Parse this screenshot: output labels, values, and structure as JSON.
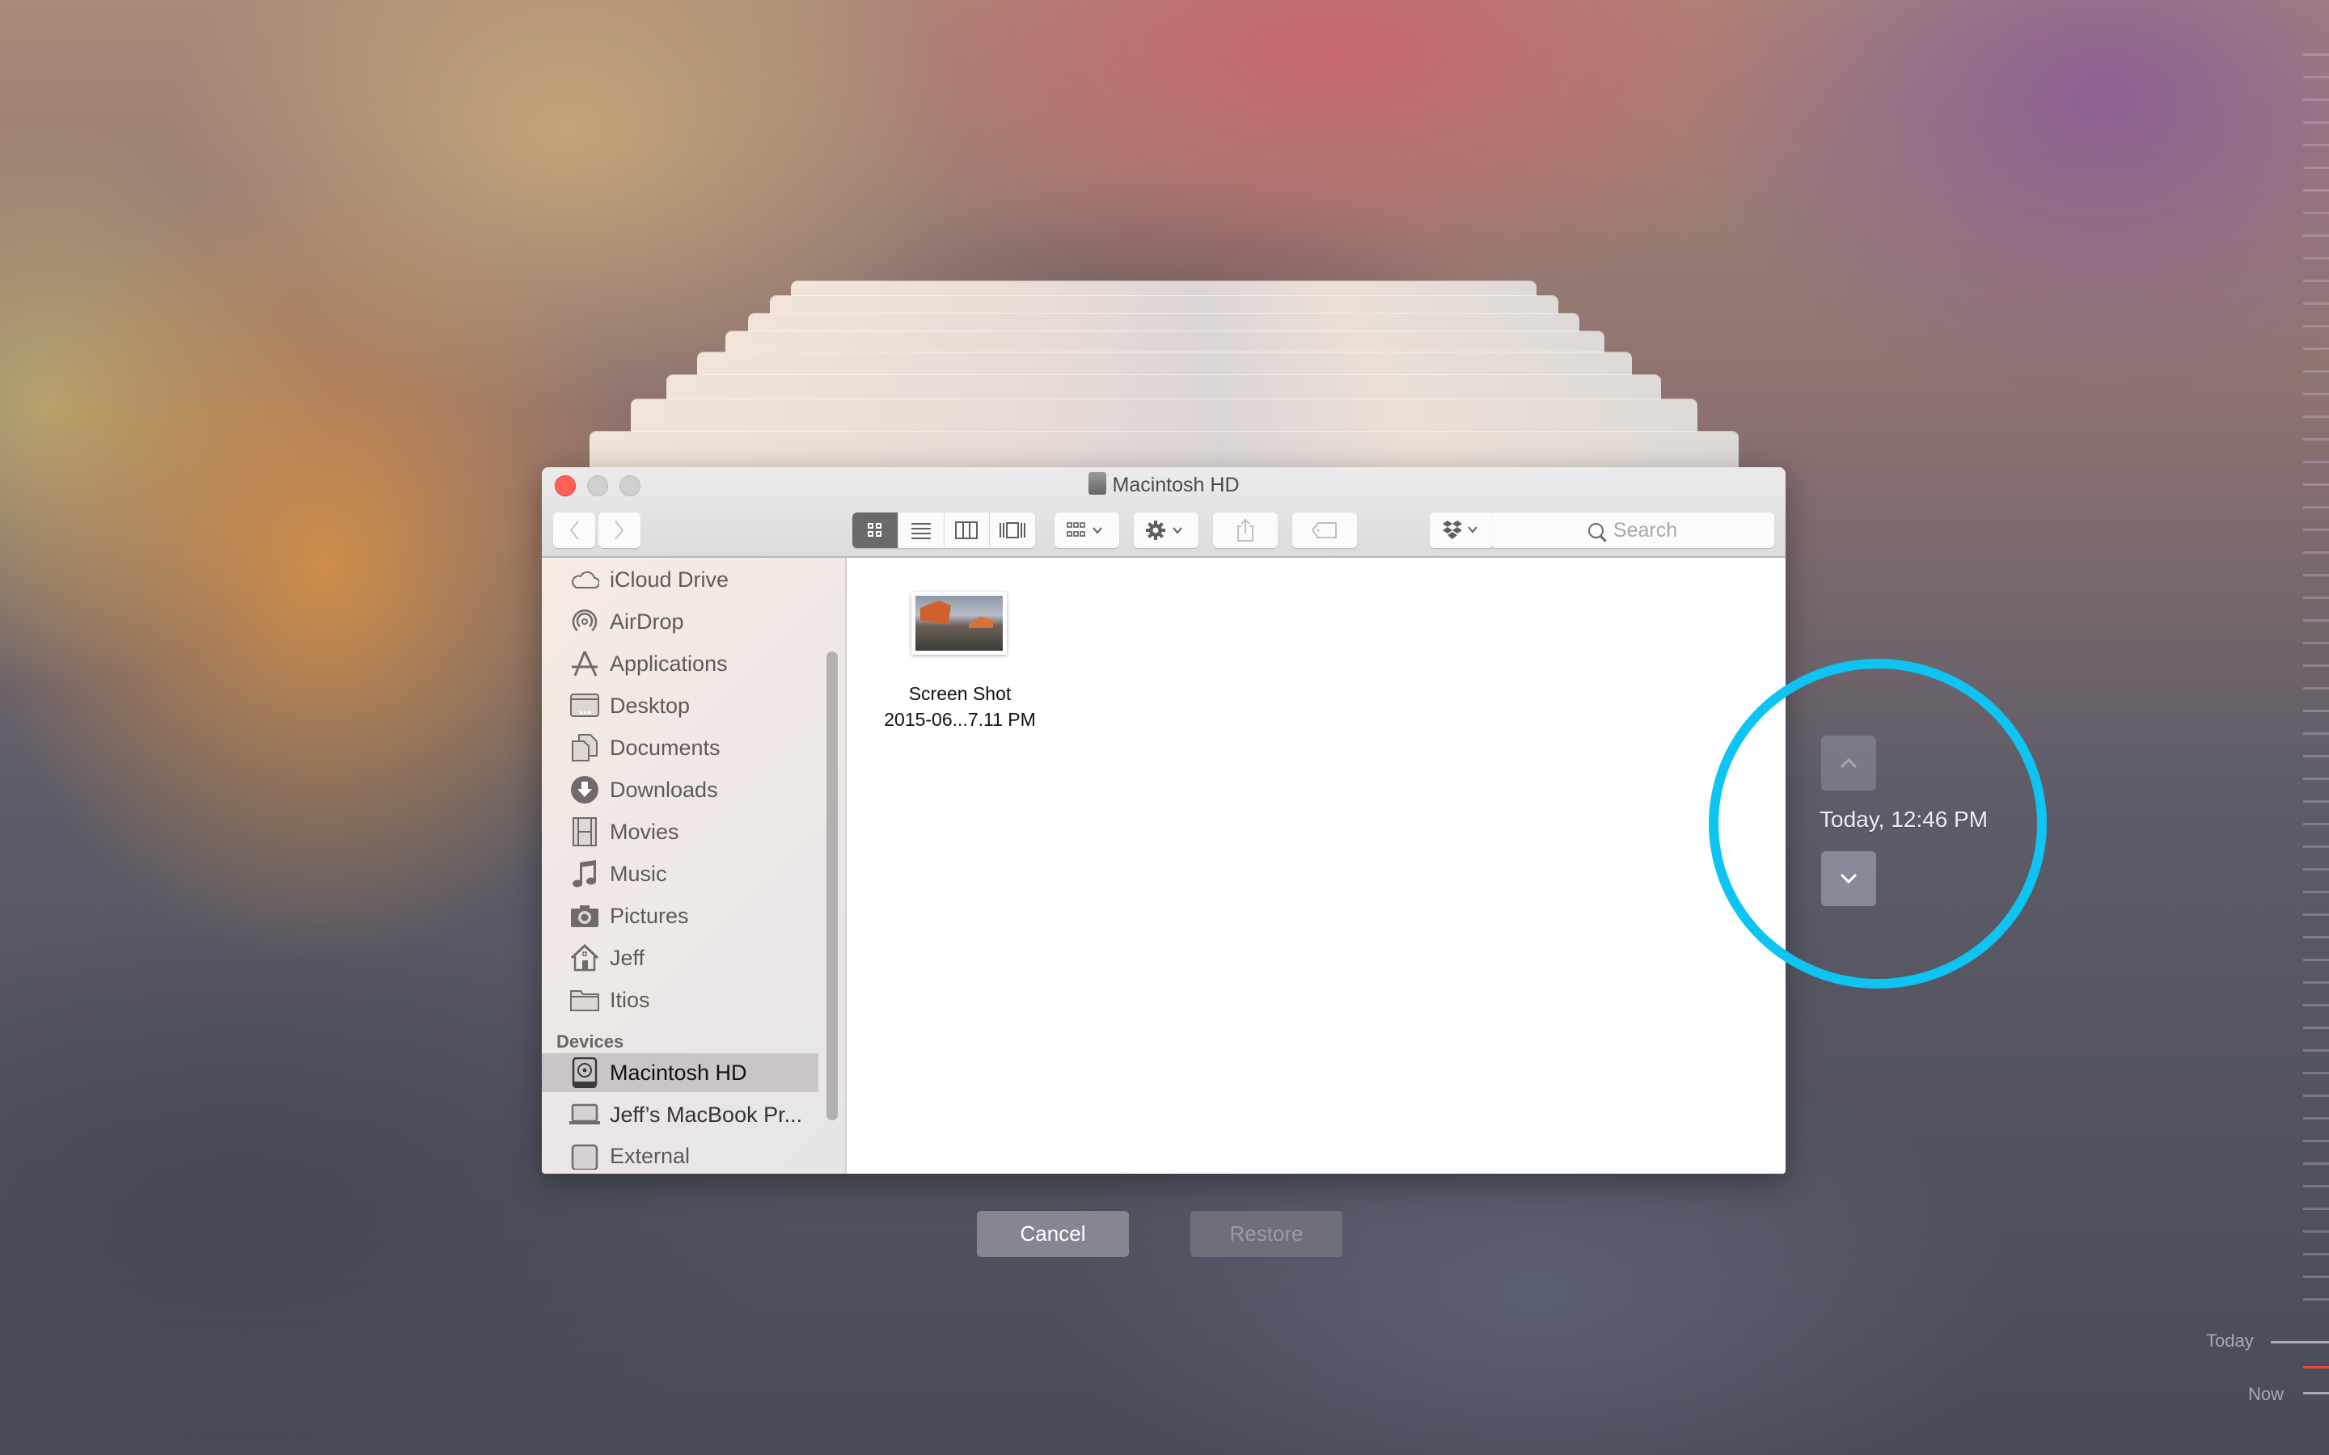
{
  "window": {
    "title": "Macintosh HD",
    "toolbar": {
      "back_icon": "chevron-left-icon",
      "forward_icon": "chevron-right-icon",
      "view_modes": [
        "icon-view",
        "list-view",
        "column-view",
        "cover-flow-view"
      ],
      "active_view": "icon-view",
      "arrange_icon": "arrange-grid-icon",
      "action_icon": "gear-icon",
      "share_icon": "share-icon",
      "tag_icon": "tag-icon",
      "dropbox_icon": "dropbox-icon",
      "search_placeholder": "Search"
    },
    "sidebar": {
      "favorites": [
        {
          "label": "iCloud Drive",
          "icon": "cloud-icon"
        },
        {
          "label": "AirDrop",
          "icon": "airdrop-icon"
        },
        {
          "label": "Applications",
          "icon": "applications-icon"
        },
        {
          "label": "Desktop",
          "icon": "desktop-icon"
        },
        {
          "label": "Documents",
          "icon": "documents-icon"
        },
        {
          "label": "Downloads",
          "icon": "downloads-icon"
        },
        {
          "label": "Movies",
          "icon": "movies-icon"
        },
        {
          "label": "Music",
          "icon": "music-icon"
        },
        {
          "label": "Pictures",
          "icon": "camera-icon"
        },
        {
          "label": "Jeff",
          "icon": "home-icon"
        },
        {
          "label": "Itios",
          "icon": "folder-icon"
        }
      ],
      "devices_header": "Devices",
      "devices": [
        {
          "label": "Macintosh HD",
          "icon": "hard-drive-icon",
          "selected": true
        },
        {
          "label": "Jeff’s MacBook Pr...",
          "icon": "laptop-icon",
          "selected": false
        },
        {
          "label": "External",
          "icon": "external-drive-icon",
          "selected": false
        }
      ]
    },
    "files": [
      {
        "name_line1": "Screen Shot",
        "name_line2": "2015-06...7.11 PM",
        "icon": "image-thumbnail"
      }
    ]
  },
  "time_machine": {
    "current_time": "Today, 12:46 PM",
    "up_icon": "chevron-up-icon",
    "down_icon": "chevron-down-icon",
    "cancel_label": "Cancel",
    "restore_label": "Restore",
    "timeline_labels": {
      "today": "Today",
      "now": "Now"
    },
    "highlight_color": "#0ec4f3",
    "now_marker_color": "#e8453c"
  }
}
